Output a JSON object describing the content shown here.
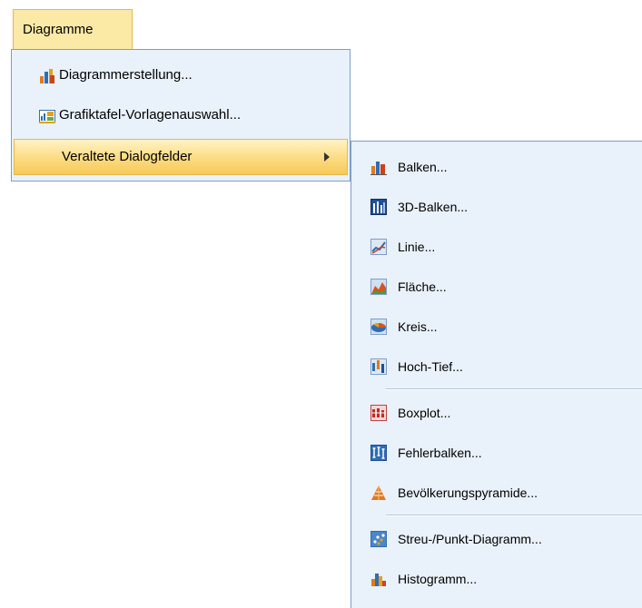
{
  "menubar": {
    "title": "Diagramme"
  },
  "main_menu": {
    "items": [
      {
        "label": "Diagrammerstellung...",
        "icon": "chart-builder-icon"
      },
      {
        "label": "Grafiktafel-Vorlagenauswahl...",
        "icon": "graphboard-icon"
      },
      {
        "label": "Veraltete Dialogfelder",
        "icon": "",
        "has_submenu": true
      }
    ]
  },
  "sub_menu": {
    "items": [
      {
        "label": "Balken...",
        "icon": "bar-chart-icon"
      },
      {
        "label": "3D-Balken...",
        "icon": "3d-bar-chart-icon"
      },
      {
        "label": "Linie...",
        "icon": "line-chart-icon"
      },
      {
        "label": "Fläche...",
        "icon": "area-chart-icon"
      },
      {
        "label": "Kreis...",
        "icon": "pie-chart-icon"
      },
      {
        "label": "Hoch-Tief...",
        "icon": "high-low-chart-icon"
      },
      {
        "label": "Boxplot...",
        "icon": "boxplot-icon"
      },
      {
        "label": "Fehlerbalken...",
        "icon": "error-bar-icon"
      },
      {
        "label": "Bevölkerungspyramide...",
        "icon": "population-pyramid-icon"
      },
      {
        "label": "Streu-/Punkt-Diagramm...",
        "icon": "scatter-plot-icon"
      },
      {
        "label": "Histogramm...",
        "icon": "histogram-icon"
      }
    ]
  },
  "colors": {
    "menu_bg": "#e9f1fa",
    "menu_border": "#7d9ec9",
    "highlight": "#fbd97c"
  }
}
